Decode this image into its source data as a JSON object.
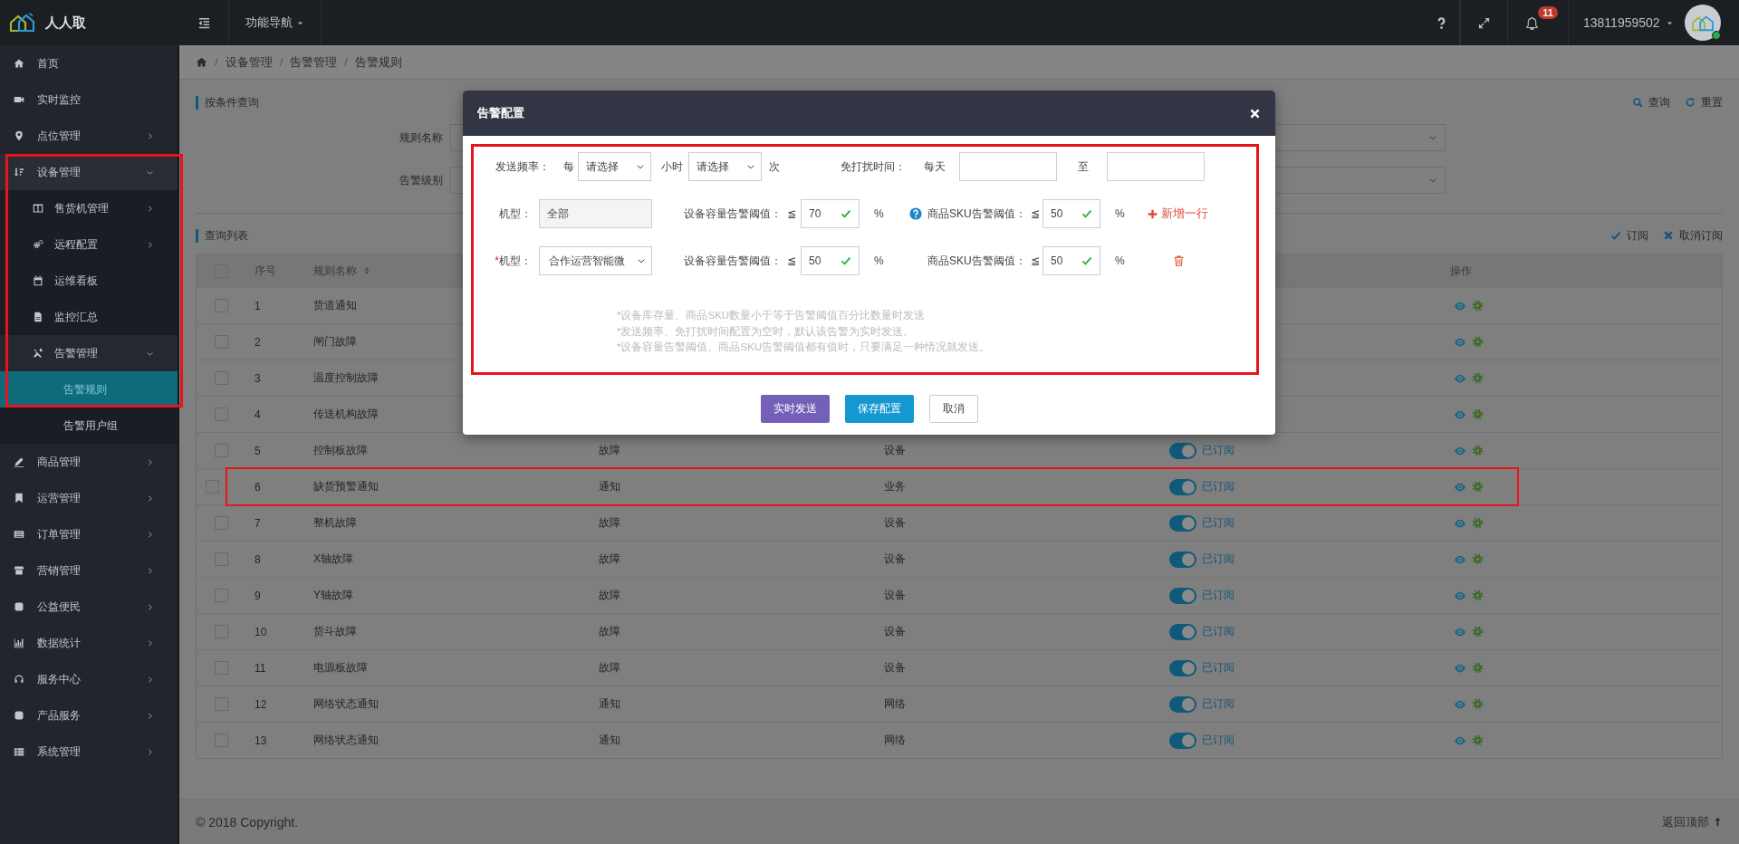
{
  "app": {
    "name": "人人取"
  },
  "topbar": {
    "nav_menu": "功能导航",
    "notifications": {
      "count": "11"
    },
    "user": {
      "phone": "13811959502",
      "online": true
    }
  },
  "sidebar": {
    "items": [
      {
        "label": "首页",
        "expandable": false,
        "selected": false,
        "highlighted": false
      },
      {
        "label": "实时监控",
        "expandable": false,
        "selected": false,
        "highlighted": false
      },
      {
        "label": "点位管理",
        "expandable": true,
        "expanded": false,
        "selected": false,
        "highlighted": false
      },
      {
        "label": "设备管理",
        "expandable": true,
        "expanded": true,
        "selected": false,
        "highlighted": true,
        "children": [
          {
            "label": "售货机管理",
            "expandable": true,
            "expanded": false,
            "selected": false
          },
          {
            "label": "远程配置",
            "expandable": true,
            "expanded": false,
            "selected": false
          },
          {
            "label": "运维看板",
            "expandable": false,
            "selected": false
          },
          {
            "label": "监控汇总",
            "expandable": false,
            "selected": false
          },
          {
            "label": "告警管理",
            "expandable": true,
            "expanded": true,
            "selected": false,
            "children": [
              {
                "label": "告警规则",
                "expandable": false,
                "selected": true
              },
              {
                "label": "告警用户组",
                "expandable": false,
                "selected": false
              }
            ]
          }
        ]
      },
      {
        "label": "商品管理",
        "expandable": true,
        "expanded": false,
        "selected": false,
        "highlighted": false
      },
      {
        "label": "运营管理",
        "expandable": true,
        "expanded": false,
        "selected": false,
        "highlighted": false
      },
      {
        "label": "订单管理",
        "expandable": true,
        "expanded": false,
        "selected": false,
        "highlighted": false
      },
      {
        "label": "营销管理",
        "expandable": true,
        "expanded": false,
        "selected": false,
        "highlighted": false
      },
      {
        "label": "公益便民",
        "expandable": true,
        "expanded": false,
        "selected": false,
        "highlighted": false
      },
      {
        "label": "数据统计",
        "expandable": true,
        "expanded": false,
        "selected": false,
        "highlighted": false
      },
      {
        "label": "服务中心",
        "expandable": true,
        "expanded": false,
        "selected": false,
        "highlighted": false
      },
      {
        "label": "产品服务",
        "expandable": true,
        "expanded": false,
        "selected": false,
        "highlighted": false
      },
      {
        "label": "系统管理",
        "expandable": true,
        "expanded": false,
        "selected": false,
        "highlighted": false
      }
    ]
  },
  "breadcrumb": [
    {
      "separator": "/",
      "label": "设备管理"
    },
    {
      "separator": "/",
      "label": "告警管理"
    },
    {
      "separator": "/",
      "label": "告警规则"
    }
  ],
  "filter": {
    "title": "按条件查询",
    "actions": [
      "查询",
      "重置"
    ],
    "fields": [
      {
        "label": "规则名称"
      },
      {
        "label": "告警级别"
      }
    ]
  },
  "list": {
    "title": "查询列表",
    "actions": [
      "订阅",
      "取消订阅"
    ]
  },
  "table": {
    "header": {
      "checked": false,
      "seq": "序号",
      "name": "规则名称",
      "name_sortable": true,
      "actions": "操作"
    },
    "rows": [
      {
        "checked": false,
        "highlighted": false,
        "seq": "1",
        "name": "货道通知"
      },
      {
        "checked": false,
        "highlighted": false,
        "seq": "2",
        "name": "闸门故障"
      },
      {
        "checked": false,
        "highlighted": false,
        "seq": "3",
        "name": "温度控制故障"
      },
      {
        "checked": false,
        "highlighted": false,
        "seq": "4",
        "name": "传送机构故障"
      },
      {
        "checked": false,
        "highlighted": false,
        "seq": "5",
        "name": "控制板故障",
        "type": "故障",
        "category": "设备",
        "subscribed": true,
        "status": "已订阅"
      },
      {
        "checked": false,
        "highlighted": true,
        "seq": "6",
        "name": "缺货预警通知",
        "type": "通知",
        "category": "业务",
        "subscribed": true,
        "status": "已订阅"
      },
      {
        "checked": false,
        "highlighted": false,
        "seq": "7",
        "name": "整机故障",
        "type": "故障",
        "category": "设备",
        "subscribed": true,
        "status": "已订阅"
      },
      {
        "checked": false,
        "highlighted": false,
        "seq": "8",
        "name": "X轴故障",
        "type": "故障",
        "category": "设备",
        "subscribed": true,
        "status": "已订阅"
      },
      {
        "checked": false,
        "highlighted": false,
        "seq": "9",
        "name": "Y轴故障",
        "type": "故障",
        "category": "设备",
        "subscribed": true,
        "status": "已订阅"
      },
      {
        "checked": false,
        "highlighted": false,
        "seq": "10",
        "name": "货斗故障",
        "type": "故障",
        "category": "设备",
        "subscribed": true,
        "status": "已订阅"
      },
      {
        "checked": false,
        "highlighted": false,
        "seq": "11",
        "name": "电源板故障",
        "type": "故障",
        "category": "设备",
        "subscribed": true,
        "status": "已订阅"
      },
      {
        "checked": false,
        "highlighted": false,
        "seq": "12",
        "name": "网络状态通知",
        "type": "通知",
        "category": "网络",
        "subscribed": true,
        "status": "已订阅"
      },
      {
        "checked": false,
        "highlighted": false,
        "seq": "13",
        "name": "网络状态通知",
        "type": "通知",
        "category": "网络",
        "subscribed": true,
        "status": "已订阅"
      }
    ]
  },
  "modal": {
    "title": "告警配置",
    "highlighted": true,
    "frequency": {
      "label": "发送频率：",
      "every": "每",
      "hours_select": "请选择",
      "hours_unit": "小时",
      "count_select": "请选择",
      "count_unit": "次"
    },
    "quiet": {
      "label": "免打扰时间：",
      "daily": "每天",
      "separator": "至"
    },
    "rules": [
      {
        "kind": "fixed",
        "required": false,
        "label": "机型：",
        "model": "全部",
        "capacity_label": "设备容量告警阈值：",
        "capacity_op": "≦",
        "capacity": "70",
        "capacity_valid": true,
        "capacity_unit": "%",
        "sku_help": true,
        "sku_label": "商品SKU告警阈值：",
        "sku_op": "≦",
        "sku": "50",
        "sku_valid": true,
        "sku_unit": "%",
        "action": {
          "kind": "add",
          "label": "新增一行"
        }
      },
      {
        "kind": "select",
        "required": true,
        "required_mark": "*",
        "label": "机型：",
        "model": "合作运营智能微",
        "capacity_label": "设备容量告警阈值：",
        "capacity_op": "≦",
        "capacity": "50",
        "capacity_valid": true,
        "capacity_unit": "%",
        "sku_help": false,
        "sku_label": "商品SKU告警阈值：",
        "sku_op": "≦",
        "sku": "50",
        "sku_valid": true,
        "sku_unit": "%",
        "action": {
          "kind": "delete"
        }
      }
    ],
    "notes": [
      "*设备库存量、商品SKU数量小于等于告警阈值百分比数量时发送",
      "*发送频率、免打扰时间配置为空时，默认该告警为实时发送。",
      "*设备容量告警阈值、商品SKU告警阈值都有值时，只要满足一种情况就发送。"
    ],
    "buttons": [
      {
        "kind": "send",
        "label": "实时发送"
      },
      {
        "kind": "save",
        "label": "保存配置"
      },
      {
        "kind": "cancel",
        "label": "取消"
      }
    ]
  },
  "footer": {
    "copyright": "© 2018 Copyright.",
    "back_to_top": "返回顶部"
  }
}
